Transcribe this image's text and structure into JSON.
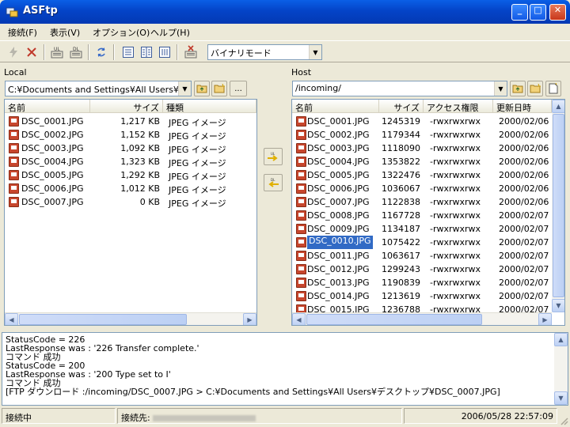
{
  "window": {
    "title": "ASFtp",
    "minimize": "_",
    "maximize": "□",
    "close": "✕"
  },
  "menu": [
    "接続(F)",
    "表示(V)",
    "オプション(O)",
    "ヘルプ(H)"
  ],
  "toolbar": {
    "mode_select": "バイナリモード",
    "icons": [
      "connect-icon",
      "disconnect-icon",
      "upload-icon",
      "download-icon",
      "refresh-icon",
      "list-view-icon",
      "detail-view-icon",
      "icon-view-icon",
      "delete-icon"
    ]
  },
  "local": {
    "label": "Local",
    "path": "C:¥Documents and Settings¥All Users¥デ",
    "browse": "...",
    "columns": [
      "名前",
      "サイズ",
      "種類"
    ],
    "files": [
      {
        "name": "DSC_0001.JPG",
        "size": "1,217 KB",
        "type": "JPEG イメージ"
      },
      {
        "name": "DSC_0002.JPG",
        "size": "1,152 KB",
        "type": "JPEG イメージ"
      },
      {
        "name": "DSC_0003.JPG",
        "size": "1,092 KB",
        "type": "JPEG イメージ"
      },
      {
        "name": "DSC_0004.JPG",
        "size": "1,323 KB",
        "type": "JPEG イメージ"
      },
      {
        "name": "DSC_0005.JPG",
        "size": "1,292 KB",
        "type": "JPEG イメージ"
      },
      {
        "name": "DSC_0006.JPG",
        "size": "1,012 KB",
        "type": "JPEG イメージ"
      },
      {
        "name": "DSC_0007.JPG",
        "size": "0 KB",
        "type": "JPEG イメージ"
      }
    ]
  },
  "transfer": {
    "upload_label": "UL",
    "download_label": "DL"
  },
  "host": {
    "label": "Host",
    "path": "/incoming/",
    "columns": [
      "名前",
      "サイズ",
      "アクセス権限",
      "更新日時"
    ],
    "selected_index": 9,
    "files": [
      {
        "name": "DSC_0001.JPG",
        "size": "1245319",
        "perm": "-rwxrwxrwx",
        "date": "2000/02/06"
      },
      {
        "name": "DSC_0002.JPG",
        "size": "1179344",
        "perm": "-rwxrwxrwx",
        "date": "2000/02/06"
      },
      {
        "name": "DSC_0003.JPG",
        "size": "1118090",
        "perm": "-rwxrwxrwx",
        "date": "2000/02/06"
      },
      {
        "name": "DSC_0004.JPG",
        "size": "1353822",
        "perm": "-rwxrwxrwx",
        "date": "2000/02/06"
      },
      {
        "name": "DSC_0005.JPG",
        "size": "1322476",
        "perm": "-rwxrwxrwx",
        "date": "2000/02/06"
      },
      {
        "name": "DSC_0006.JPG",
        "size": "1036067",
        "perm": "-rwxrwxrwx",
        "date": "2000/02/06"
      },
      {
        "name": "DSC_0007.JPG",
        "size": "1122838",
        "perm": "-rwxrwxrwx",
        "date": "2000/02/06"
      },
      {
        "name": "DSC_0008.JPG",
        "size": "1167728",
        "perm": "-rwxrwxrwx",
        "date": "2000/02/07"
      },
      {
        "name": "DSC_0009.JPG",
        "size": "1134187",
        "perm": "-rwxrwxrwx",
        "date": "2000/02/07"
      },
      {
        "name": "DSC_0010.JPG",
        "size": "1075422",
        "perm": "-rwxrwxrwx",
        "date": "2000/02/07"
      },
      {
        "name": "DSC_0011.JPG",
        "size": "1063617",
        "perm": "-rwxrwxrwx",
        "date": "2000/02/07"
      },
      {
        "name": "DSC_0012.JPG",
        "size": "1299243",
        "perm": "-rwxrwxrwx",
        "date": "2000/02/07"
      },
      {
        "name": "DSC_0013.JPG",
        "size": "1190839",
        "perm": "-rwxrwxrwx",
        "date": "2000/02/07"
      },
      {
        "name": "DSC_0014.JPG",
        "size": "1213619",
        "perm": "-rwxrwxrwx",
        "date": "2000/02/07"
      },
      {
        "name": "DSC_0015.JPG",
        "size": "1236788",
        "perm": "-rwxrwxrwx",
        "date": "2000/02/07"
      }
    ]
  },
  "log": [
    "StatusCode = 226",
    "LastResponse was : '226 Transfer complete.'",
    "コマンド 成功",
    "StatusCode = 200",
    "LastResponse was : '200 Type set to I'",
    "コマンド 成功",
    "[FTP ダウンロード :/incoming/DSC_0007.JPG > C:¥Documents and Settings¥All Users¥デスクトップ¥DSC_0007.JPG]"
  ],
  "status": {
    "connection": "接続中",
    "host_label": "接続先:",
    "timestamp": "2006/05/28 22:57:09"
  },
  "colors": {
    "titlebar": "#0444c8",
    "selection": "#316ac5",
    "window_bg": "#ece9d8"
  }
}
